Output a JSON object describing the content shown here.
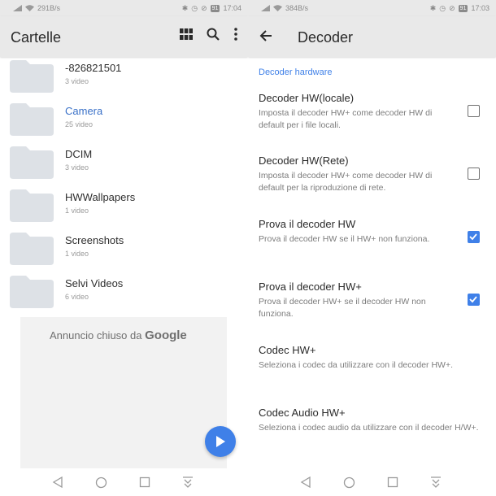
{
  "left": {
    "status": {
      "speed": "291B/s",
      "battery": "91",
      "time": "17:04"
    },
    "title": "Cartelle",
    "folders": [
      {
        "name": "-826821501",
        "count": "3 video"
      },
      {
        "name": "Camera",
        "count": "25 video"
      },
      {
        "name": "DCIM",
        "count": "3 video"
      },
      {
        "name": "HWWallpapers",
        "count": "1 video"
      },
      {
        "name": "Screenshots",
        "count": "1 video"
      },
      {
        "name": "Selvi Videos",
        "count": "6 video"
      }
    ],
    "ad": {
      "text": "Annuncio chiuso da",
      "brand": "Google"
    }
  },
  "right": {
    "status": {
      "speed": "384B/s",
      "battery": "91",
      "time": "17:03"
    },
    "title": "Decoder",
    "section": "Decoder hardware",
    "prefs": [
      {
        "title": "Decoder HW(locale)",
        "summary": "Imposta il decoder HW+ come decoder HW di default per i file locali.",
        "checked": false
      },
      {
        "title": "Decoder HW(Rete)",
        "summary": "Imposta il decoder HW+ come decoder HW di default per la riproduzione di rete.",
        "checked": false
      },
      {
        "title": "Prova il decoder HW",
        "summary": "Prova il decoder HW se il HW+ non funziona.",
        "checked": true
      },
      {
        "title": "Prova il decoder HW+",
        "summary": "Prova il decoder HW+ se il decoder HW non funziona.",
        "checked": true
      },
      {
        "title": "Codec HW+",
        "summary": "Seleziona i codec da utilizzare con il decoder HW+."
      },
      {
        "title": "Codec Audio HW+",
        "summary": "Seleziona i codec audio da utilizzare con il decoder H/W+."
      }
    ]
  },
  "colors": {
    "accent": "#3f80e8",
    "appbar": "#e9e9e9",
    "folder": "#dde1e6"
  },
  "icons": [
    "grid-icon",
    "search-icon",
    "more-vert-icon",
    "back-arrow-icon",
    "folder-icon",
    "play-icon",
    "nav-back-icon",
    "nav-home-icon",
    "nav-recents-icon",
    "nav-notifications-icon"
  ]
}
